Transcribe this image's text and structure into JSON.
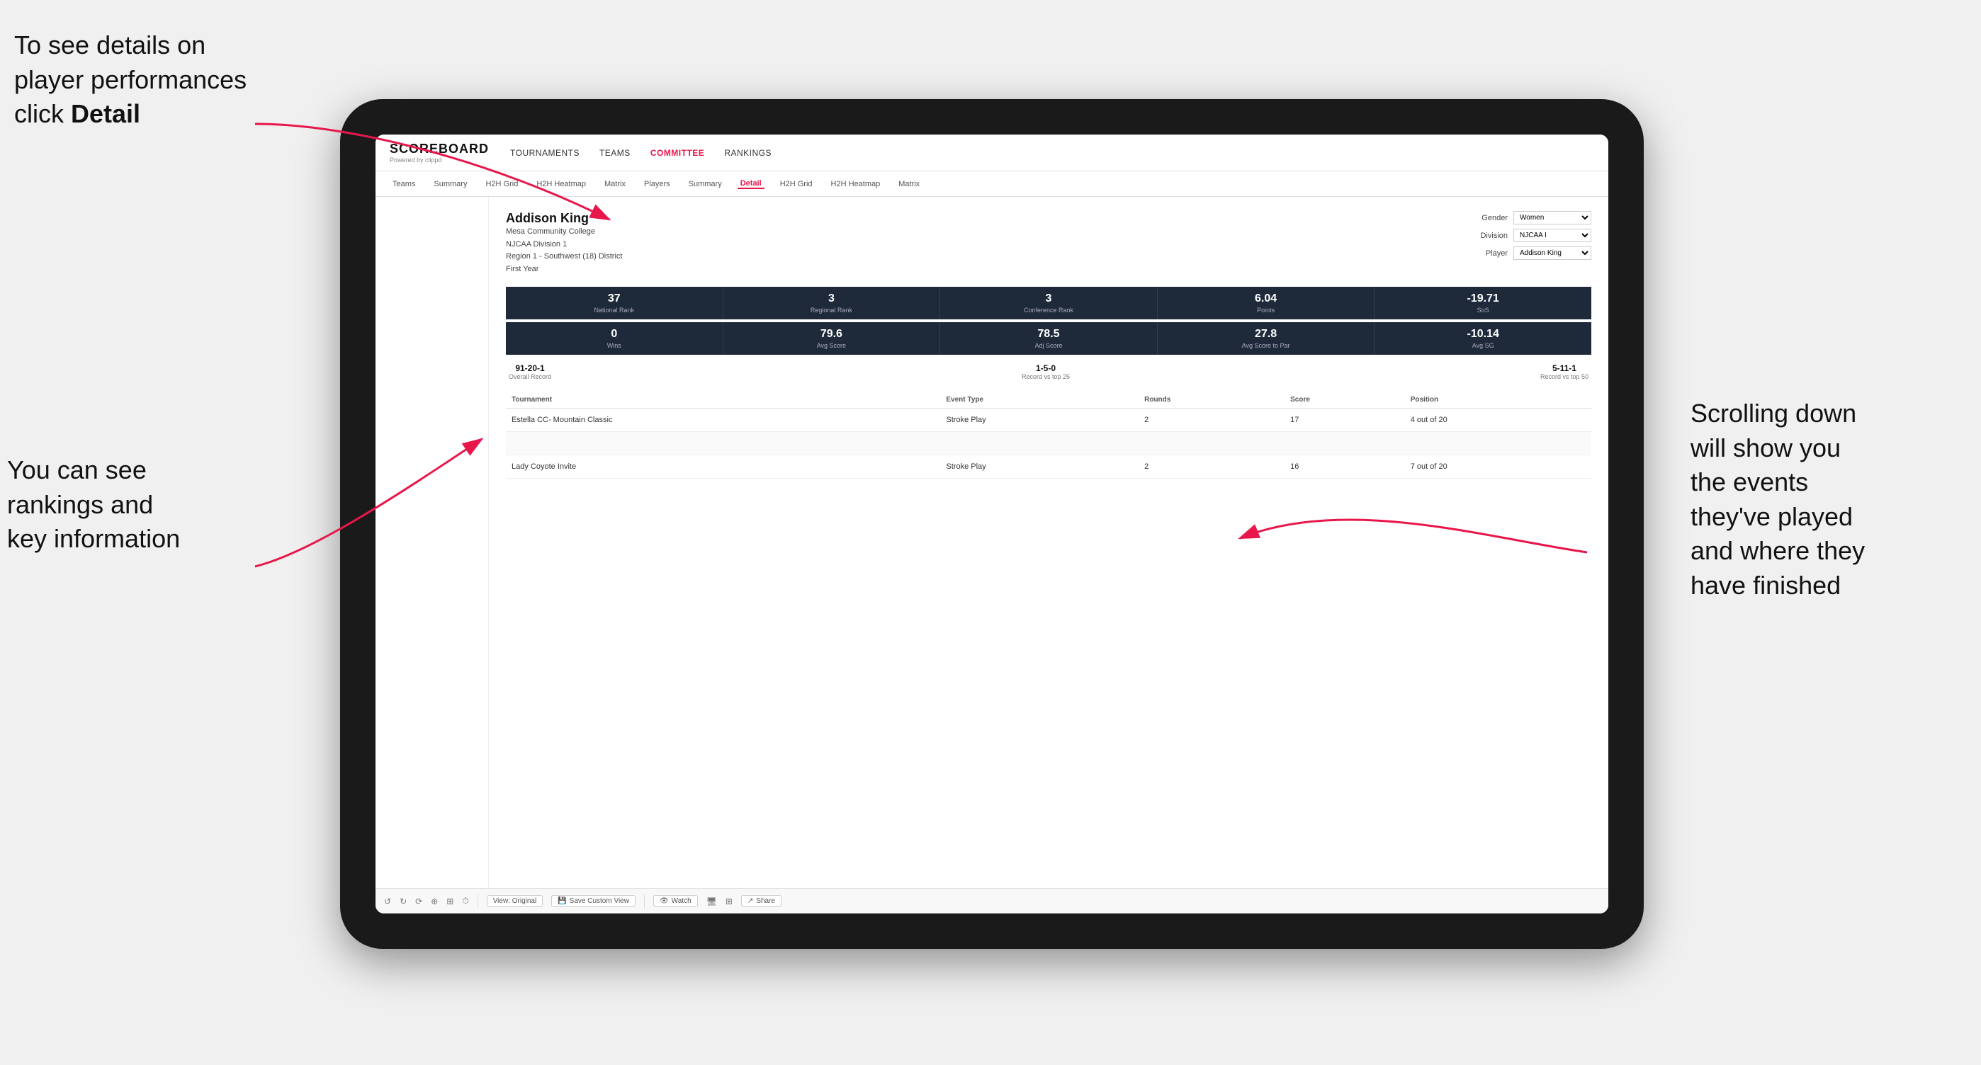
{
  "annotations": {
    "topleft": "To see details on player performances click ",
    "topleft_bold": "Detail",
    "bottomleft_line1": "You can see",
    "bottomleft_line2": "rankings and",
    "bottomleft_line3": "key information",
    "right_line1": "Scrolling down",
    "right_line2": "will show you",
    "right_line3": "the events",
    "right_line4": "they've played",
    "right_line5": "and where they",
    "right_line6": "have finished"
  },
  "nav": {
    "logo": "SCOREBOARD",
    "logo_sub": "Powered by clippd",
    "main_items": [
      "TOURNAMENTS",
      "TEAMS",
      "COMMITTEE",
      "RANKINGS"
    ],
    "sub_items": [
      "Teams",
      "Summary",
      "H2H Grid",
      "H2H Heatmap",
      "Matrix",
      "Players",
      "Summary",
      "Detail",
      "H2H Grid",
      "H2H Heatmap",
      "Matrix"
    ],
    "active_main": "COMMITTEE",
    "active_sub": "Detail"
  },
  "player": {
    "name": "Addison King",
    "school": "Mesa Community College",
    "division": "NJCAA Division 1",
    "region": "Region 1 - Southwest (18) District",
    "year": "First Year",
    "gender_label": "Gender",
    "gender_value": "Women",
    "division_label": "Division",
    "division_value": "NJCAA I",
    "player_label": "Player",
    "player_value": "Addison King"
  },
  "stats_row1": [
    {
      "value": "37",
      "label": "National Rank"
    },
    {
      "value": "3",
      "label": "Regional Rank"
    },
    {
      "value": "3",
      "label": "Conference Rank"
    },
    {
      "value": "6.04",
      "label": "Points"
    },
    {
      "value": "-19.71",
      "label": "SoS"
    }
  ],
  "stats_row2": [
    {
      "value": "0",
      "label": "Wins"
    },
    {
      "value": "79.6",
      "label": "Avg Score"
    },
    {
      "value": "78.5",
      "label": "Adj Score"
    },
    {
      "value": "27.8",
      "label": "Avg Score to Par"
    },
    {
      "value": "-10.14",
      "label": "Avg SG"
    }
  ],
  "records": [
    {
      "value": "91-20-1",
      "label": "Overall Record"
    },
    {
      "value": "1-5-0",
      "label": "Record vs top 25"
    },
    {
      "value": "5-11-1",
      "label": "Record vs top 50"
    }
  ],
  "table": {
    "headers": [
      "Tournament",
      "Event Type",
      "Rounds",
      "Score",
      "Position"
    ],
    "rows": [
      {
        "tournament": "Estella CC- Mountain Classic",
        "event_type": "Stroke Play",
        "rounds": "2",
        "score": "17",
        "position": "4 out of 20"
      },
      {
        "tournament": "",
        "event_type": "",
        "rounds": "",
        "score": "",
        "position": ""
      },
      {
        "tournament": "Lady Coyote Invite",
        "event_type": "Stroke Play",
        "rounds": "2",
        "score": "16",
        "position": "7 out of 20"
      }
    ]
  },
  "toolbar": {
    "view_original": "View: Original",
    "save_custom": "Save Custom View",
    "watch": "Watch",
    "share": "Share"
  }
}
